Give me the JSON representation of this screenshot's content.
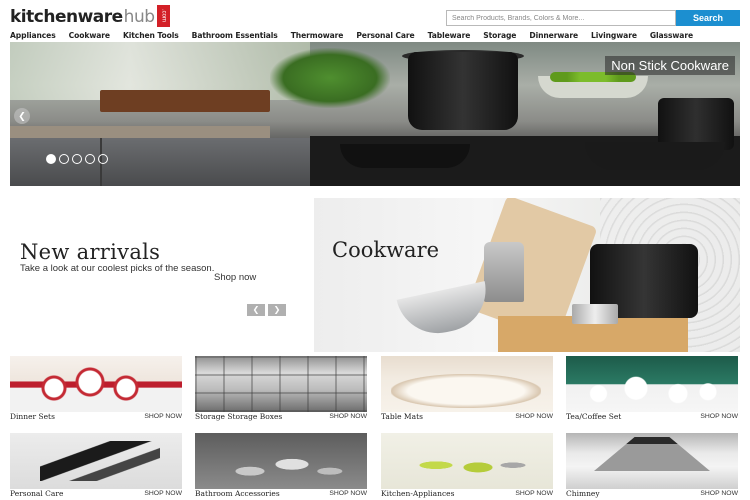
{
  "header": {
    "logo": {
      "word": "kitchenware",
      "hub": "hub",
      "badge": ".com"
    },
    "search": {
      "placeholder": "Search Products, Brands, Colors & More...",
      "button_label": "Search"
    }
  },
  "nav": {
    "items": [
      "Appliances",
      "Cookware",
      "Kitchen Tools",
      "Bathroom Essentials",
      "Thermoware",
      "Personal Care",
      "Tableware",
      "Storage",
      "Dinnerware",
      "Livingware",
      "Glassware"
    ]
  },
  "hero": {
    "caption": "Non Stick Cookware",
    "slide_count": 5,
    "active_slide": 1
  },
  "promo": {
    "title": "New arrivals",
    "subtitle": "Take a look at our coolest picks of the season.",
    "link": "Shop now",
    "banner_title": "Cookware"
  },
  "products": [
    {
      "name": "Dinner Sets",
      "cta": "SHOP NOW"
    },
    {
      "name": "Storage Storage Boxes",
      "cta": "SHOP NOW"
    },
    {
      "name": "Table Mats",
      "cta": "SHOP NOW"
    },
    {
      "name": "Tea/Coffee Set",
      "cta": "SHOP NOW"
    },
    {
      "name": "Personal Care",
      "cta": "SHOP NOW"
    },
    {
      "name": "Bathroom Accessories",
      "cta": "SHOP NOW"
    },
    {
      "name": "Kitchen-Appliances",
      "cta": "SHOP NOW"
    },
    {
      "name": "Chimney",
      "cta": "SHOP NOW"
    }
  ],
  "colors": {
    "search_button": "#1c8fd0",
    "logo_badge": "#d32027"
  }
}
